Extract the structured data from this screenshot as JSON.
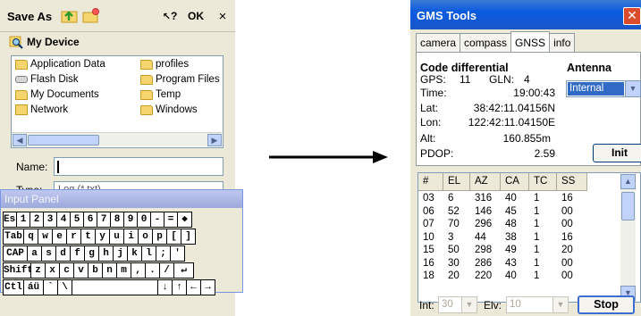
{
  "save_dialog": {
    "title": "Save As",
    "help_label": "?",
    "ok_label": "OK",
    "close_label": "×",
    "location": "My Device",
    "files_left": [
      "Application Data",
      "Flash Disk",
      "My Documents",
      "Network"
    ],
    "files_right": [
      "profiles",
      "Program Files",
      "Temp",
      "Windows"
    ],
    "name_label": "Name:",
    "name_value": "",
    "type_label": "Type:",
    "type_value": "Log (*.txt)"
  },
  "input_panel": {
    "title": "Input Panel",
    "rows": [
      [
        "Esc",
        "1",
        "2",
        "3",
        "4",
        "5",
        "6",
        "7",
        "8",
        "9",
        "0",
        "-",
        "=",
        "◆"
      ],
      [
        "Tab",
        "q",
        "w",
        "e",
        "r",
        "t",
        "y",
        "u",
        "i",
        "o",
        "p",
        "[",
        "]"
      ],
      [
        "CAP",
        "a",
        "s",
        "d",
        "f",
        "g",
        "h",
        "j",
        "k",
        "l",
        ";",
        "'"
      ],
      [
        "Shift",
        "z",
        "x",
        "c",
        "v",
        "b",
        "n",
        "m",
        ",",
        ".",
        "/",
        "↵"
      ],
      [
        "Ctl",
        "áü",
        "`",
        "\\",
        "",
        "↓",
        "↑",
        "←",
        "→"
      ]
    ]
  },
  "gms": {
    "title": "GMS Tools",
    "close_label": "✕",
    "tabs": [
      "camera",
      "compass",
      "GNSS",
      "info"
    ],
    "active_tab": "GNSS",
    "fix_status": "Code differential",
    "gps_label": "GPS:",
    "gps_value": "11",
    "gln_label": "GLN:",
    "gln_value": "4",
    "time_label": "Time:",
    "time_value": "19:00:43",
    "lat_label": "Lat:",
    "lat_value": "38:42:11.04156N",
    "lon_label": "Lon:",
    "lon_value": "122:42:11.04150E",
    "alt_label": "Alt:",
    "alt_value": "160.855m",
    "pdop_label": "PDOP:",
    "pdop_value": "2.59",
    "antenna_label": "Antenna",
    "antenna_value": "Internal",
    "init_label": "Init",
    "columns": [
      "#",
      "EL",
      "AZ",
      "CA",
      "TC",
      "SS"
    ],
    "rows": [
      [
        "03",
        "6",
        "316",
        "40",
        "1",
        "16"
      ],
      [
        "06",
        "52",
        "146",
        "45",
        "1",
        "00"
      ],
      [
        "07",
        "70",
        "296",
        "48",
        "1",
        "00"
      ],
      [
        "10",
        "3",
        "44",
        "38",
        "1",
        "16"
      ],
      [
        "15",
        "50",
        "298",
        "49",
        "1",
        "20"
      ],
      [
        "16",
        "30",
        "286",
        "43",
        "1",
        "00"
      ],
      [
        "18",
        "20",
        "220",
        "40",
        "1",
        "00"
      ]
    ],
    "int_label": "Int:",
    "int_value": "30",
    "elv_label": "Elv:",
    "elv_value": "10",
    "stop_label": "Stop"
  },
  "colors": {
    "titlebar": "#0a5ae0",
    "close": "#dc4c2c",
    "selection": "#316ac5"
  }
}
